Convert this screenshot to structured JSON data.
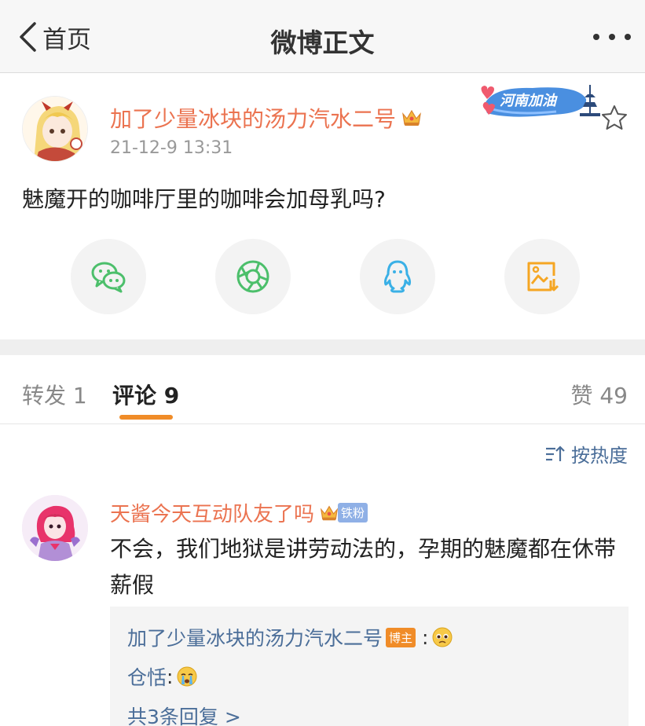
{
  "nav": {
    "back_label": "首页",
    "title": "微博正文"
  },
  "post": {
    "author": "加了少量冰块的汤力汽水二号",
    "timestamp": "21-12-9 13:31",
    "text": "魅魔开的咖啡厅里的咖啡会加母乳吗?",
    "badge_text": "河南加油"
  },
  "share": [
    {
      "icon": "wechat-icon",
      "color": "#4cbf6b"
    },
    {
      "icon": "moments-icon",
      "color": "#4cbf6b"
    },
    {
      "icon": "qq-icon",
      "color": "#3ab0e6"
    },
    {
      "icon": "save-image-icon",
      "color": "#f5a623"
    }
  ],
  "tabs": {
    "repost": "转发 1",
    "comments": "评论 9",
    "likes": "赞 49"
  },
  "sort": {
    "label": "按热度"
  },
  "comment": {
    "author": "天酱今天互动队友了吗",
    "fan_badge": "铁粉",
    "text": "不会，我们地狱是讲劳动法的，孕期的魅魔都在休带薪假",
    "replies": [
      {
        "name": "加了少量冰块的汤力汽水二号",
        "badge": "博主",
        "separator": ":"
      },
      {
        "name": "仓恬",
        "separator": ":"
      }
    ],
    "more_replies": "共3条回复 >"
  },
  "colors": {
    "accent_orange": "#eb7350",
    "link_blue": "#4b6e99",
    "tab_underline": "#f08c28"
  }
}
